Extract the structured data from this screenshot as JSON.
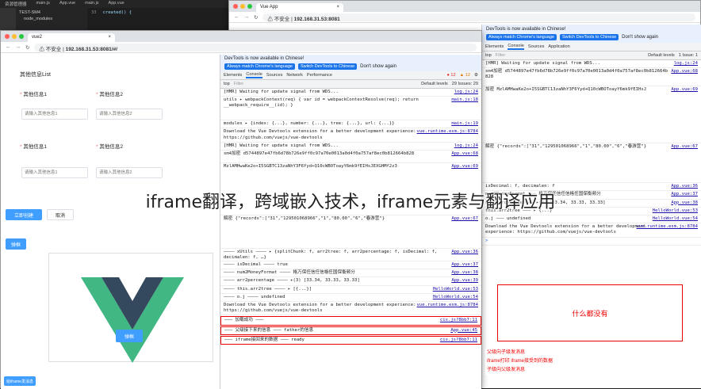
{
  "editor": {
    "tabs": [
      "资源管理器",
      "main.js",
      "App.vue",
      "main.js",
      "App.vue"
    ],
    "tree": [
      "TEST-SM4",
      "node_modules"
    ],
    "line": "33",
    "code": "created() {"
  },
  "back_window": {
    "tab_title": "Vue App",
    "url": "192.168.31.53:8081",
    "insecure": "不安全",
    "devtools_notice": "DevTools is now available in Chinese!",
    "btn_always": "Always match Chrome's language",
    "btn_switch": "Switch DevTools to Chinese",
    "btn_dont": "Don't show again",
    "tabs": [
      "Elements",
      "Console",
      "Sources",
      "Application"
    ],
    "top": "top",
    "filter": "Filter",
    "levels": "Default levels",
    "issue": "1 Issue: 1",
    "logs": [
      {
        "text": "[HMR] Waiting for update signal from WDS...",
        "src": "log.js:24"
      },
      {
        "text": "sm4加密 d5744897e47fb6d78b726e9ff0c97a70e0013a0d4f0a757af8ec0b812664b828",
        "src": "App.vue:68"
      },
      {
        "text": "加密 MzlAMHwaKe2o+I5SGBTC13zaNhY3F6Yyd+Q10cWBOToayY6mk9fEIHsJ",
        "src": "App.vue:69"
      },
      {
        "text": "解密 {\"records\":[\"31\",\"129501068966\",\"1\",\"80.00\",\"6\",\"春游营\"}",
        "src": "App.vue:67"
      },
      {
        "text": "isDecimal: f, decimalen: f",
        "src": "App.vue:36"
      },
      {
        "text": "num2MoneyFormat ——— 格万保任信任信格任国保衡频分",
        "src": "App.vue:37"
      },
      {
        "text": "arr2percentage ——— ▸(3) [33.34, 33.33, 33.33]",
        "src": "App.vue:38"
      },
      {
        "text": "this.arr2tree ——— ▸ {...}",
        "src": "HelloWorld.vue:53"
      },
      {
        "text": "o.j ——— undefined",
        "src": "HelloWorld.vue:54"
      },
      {
        "text": "Download the Vue Devtools extension for a better development experience: https://github.com/vuejs/vue-devtools",
        "src": "vue.runtime.esm.js:8784"
      }
    ],
    "placeholder": "什么都没有"
  },
  "front_window": {
    "tab_title": "vue2",
    "url": "192.168.31.53:8081/#/",
    "insecure": "不安全",
    "app": {
      "title": "其他信息List",
      "label1": "其他信息1",
      "label2": "其他信息2",
      "ph1": "请输入其他信息1",
      "ph2": "请输入其他信息2",
      "create_btn": "立即创建",
      "cancel_btn": "取消",
      "popup_btn": "弹框",
      "iframe_btn": "弹框",
      "send_btn": "给iframe发消息"
    },
    "devtools_notice": "DevTools is now available in Chinese!",
    "btn_always": "Always match Chrome's language",
    "btn_switch": "Switch DevTools to Chinese",
    "btn_dont": "Don't show again",
    "tabs": [
      "Elements",
      "Console",
      "Sources",
      "Network",
      "Performance"
    ],
    "errors": "12",
    "warnings": "12",
    "top": "top",
    "filter": "Filter",
    "levels": "Default levels",
    "issues": "29 Issues: 29",
    "logs": [
      {
        "text": "[HMR] Waiting for update signal from WDS...",
        "src": "log.js:24"
      },
      {
        "text": "utils ▸ webpackContext(req) { var id = webpackContextResolve(req); return __webpack_require__(id); }",
        "src": "main.js:18"
      },
      {
        "text": "modules ▸ {index: {...}, number: {...}, tree: {...}, url: {...}}",
        "src": "main.js:19"
      },
      {
        "text": "Download the Vue Devtools extension for a better development experience: https://github.com/vuejs/vue-devtools",
        "src": "vue.runtime.esm.js:8784"
      },
      {
        "text": "[HMR] Waiting for update signal from WDS...",
        "src": "log.js:24"
      },
      {
        "text": "sm4加密 d5744897e47fb6d78b726e9ff0c97a70e0013a0d4f0a757af8ec0b812664b828",
        "src": "App.vue:68"
      },
      {
        "text": "MzlAMHwaKe2o+I5SGBTC13zaNhY3F6Yyd+Q10cWBOToayY6mk9fEIHsJEXGHMf2z3",
        "src": "App.vue:69"
      },
      {
        "text": "解密 {\"records\":[\"31\",\"129501068966\",\"1\",\"80.00\",\"6\",\"春游营\"}",
        "src": "App.vue:67"
      },
      {
        "text": "———— xUtils ———— ▸ {splitChunk: f, arr2tree: f, arr2percentage: f, isDecimal: f, decimalen: f, …}",
        "src": "App.vue:36"
      },
      {
        "text": "———— isDecimal ———— true",
        "src": "App.vue:37"
      },
      {
        "text": "———— num2MoneyFormat ———— 格万保任信任信格任国保衡频分",
        "src": "App.vue:38"
      },
      {
        "text": "———— arr2percentage ———— ▸(3) [33.34, 33.33, 33.33]",
        "src": "App.vue:39"
      },
      {
        "text": "———— this.arr2tree ———— ▸ [{...}]",
        "src": "HelloWorld.vue:53"
      },
      {
        "text": "———— o.j ———— undefined",
        "src": "HelloWorld.vue:54"
      },
      {
        "text": "Download the Vue Devtools extension for a better development experience: https://github.com/vuejs/vue-devtools",
        "src": "vue.runtime.esm.js:8784"
      }
    ],
    "highlights": [
      {
        "text": "——— 加载成功 ———",
        "src": "cis.js?8bb7:11"
      },
      {
        "text": "——— 父级接下来的信息 ——— father的信息",
        "src": "App.vue:45"
      },
      {
        "text": "——— iframe接回来的数据 ——— ready",
        "src": "cis.js?8bb7:11"
      }
    ],
    "red_notes": [
      "父级向子级发消息",
      "iframe打印 iframe接受到的数据",
      "子级向父级发消息"
    ]
  },
  "overlay_title": "iframe翻译，跨域嵌入技术，iframe元素与翻译应用"
}
